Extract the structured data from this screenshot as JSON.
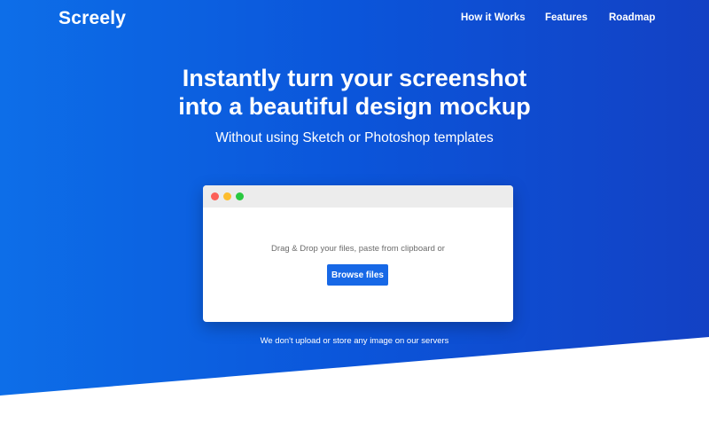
{
  "nav": {
    "logo": "Screely",
    "links": [
      {
        "label": "How it Works"
      },
      {
        "label": "Features"
      },
      {
        "label": "Roadmap"
      }
    ]
  },
  "hero": {
    "headline_line1": "Instantly turn your screenshot",
    "headline_line2": "into a beautiful design mockup",
    "subtitle": "Without using Sketch or Photoshop templates"
  },
  "upload": {
    "prompt": "Drag & Drop your files, paste from clipboard or",
    "button_label": "Browse files",
    "window_controls": [
      "close-dot",
      "minimize-dot",
      "maximize-dot"
    ]
  },
  "privacy_note": "We don't upload or store any image on our servers",
  "colors": {
    "brand_blue": "#0b55da",
    "button_blue": "#1768e6",
    "dot_red": "#fc5f57",
    "dot_yellow": "#fdbd2e",
    "dot_green": "#29c840"
  }
}
